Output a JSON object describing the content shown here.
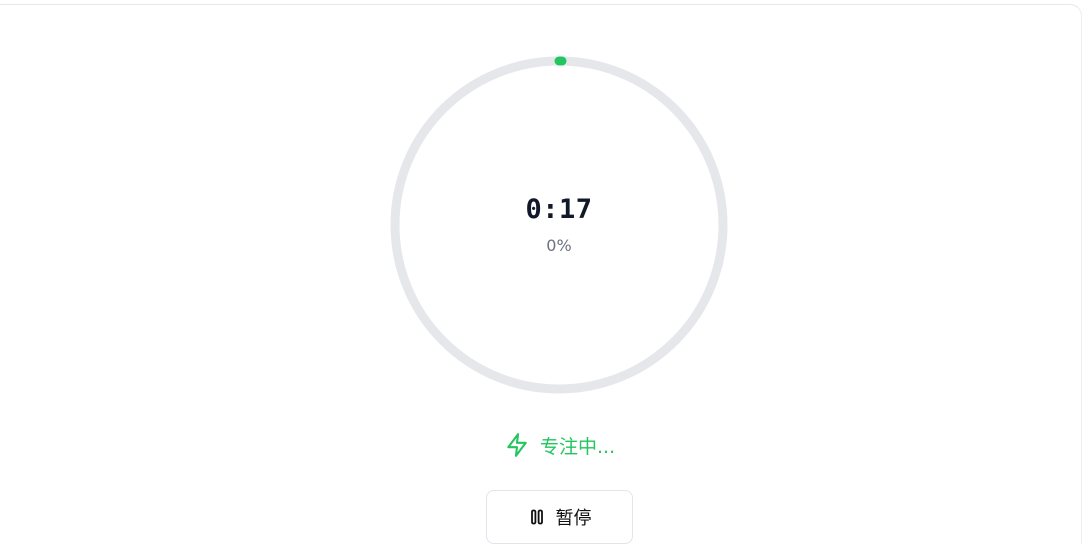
{
  "timer": {
    "time": "0:17",
    "percent_label": "0%",
    "progress": 0.0,
    "track_color": "#e5e7eb",
    "progress_color": "#22c55e"
  },
  "status": {
    "icon": "lightning-bolt-icon",
    "text": "专注中..."
  },
  "controls": {
    "pause": {
      "icon": "pause-icon",
      "label": "暂停"
    }
  }
}
